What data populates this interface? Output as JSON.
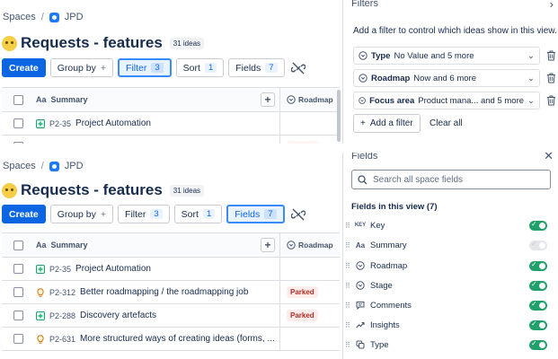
{
  "breadcrumb": {
    "root": "Spaces",
    "separator": "/",
    "project": "JPD"
  },
  "page": {
    "title": "Requests - features",
    "count": "31 ideas"
  },
  "toolbar": {
    "create": "Create",
    "group_by": "Group by",
    "filter": "Filter",
    "filter_count": "3",
    "sort": "Sort",
    "sort_count": "1",
    "fields": "Fields",
    "fields_count": "7"
  },
  "table": {
    "headers": {
      "summary": "Summary",
      "roadmap": "Roadmap",
      "summary_icon": "Aa"
    },
    "rows": [
      {
        "key": "P2-35",
        "summary": "Project Automation",
        "type": "improvement",
        "roadmap": ""
      },
      {
        "key": "P2-312",
        "summary": "Better roadmapping / the roadmapping job",
        "type": "idea",
        "roadmap": "Parked"
      },
      {
        "key": "P2-288",
        "summary": "Discovery artefacts",
        "type": "improvement",
        "roadmap": "Parked"
      },
      {
        "key": "P2-631",
        "summary": "More structured ways of creating ideas (forms, ...",
        "type": "idea",
        "roadmap": ""
      }
    ]
  },
  "filters_panel": {
    "title": "Filters",
    "description": "Add a filter to control which ideas show in this view.",
    "filters": [
      {
        "name": "Type",
        "value": "No Value and 5 more"
      },
      {
        "name": "Roadmap",
        "value": "Now and 6 more"
      },
      {
        "name": "Focus area",
        "value": "Product mana... and 5 more"
      }
    ],
    "add_filter": "Add a filter",
    "clear_all": "Clear all"
  },
  "fields_panel": {
    "title": "Fields",
    "search_placeholder": "Search all space fields",
    "section": "Fields in this view (7)",
    "fields": [
      {
        "icon": "key-icon",
        "badge": "KEY",
        "label": "Key",
        "enabled": true
      },
      {
        "icon": "text-icon",
        "badge": "Aa",
        "label": "Summary",
        "enabled": true,
        "locked": true
      },
      {
        "icon": "chevron-circle-icon",
        "label": "Roadmap",
        "enabled": true
      },
      {
        "icon": "chevron-circle-icon",
        "label": "Stage",
        "enabled": true
      },
      {
        "icon": "comment-icon",
        "label": "Comments",
        "enabled": true
      },
      {
        "icon": "trend-icon",
        "label": "Insights",
        "enabled": true
      },
      {
        "icon": "type-icon",
        "label": "Type",
        "enabled": true
      }
    ]
  },
  "colors": {
    "primary": "#0c66e4",
    "toggle_on": "#22a06b",
    "parked_text": "#ae2e24",
    "parked_bg": "#ffeceb"
  }
}
